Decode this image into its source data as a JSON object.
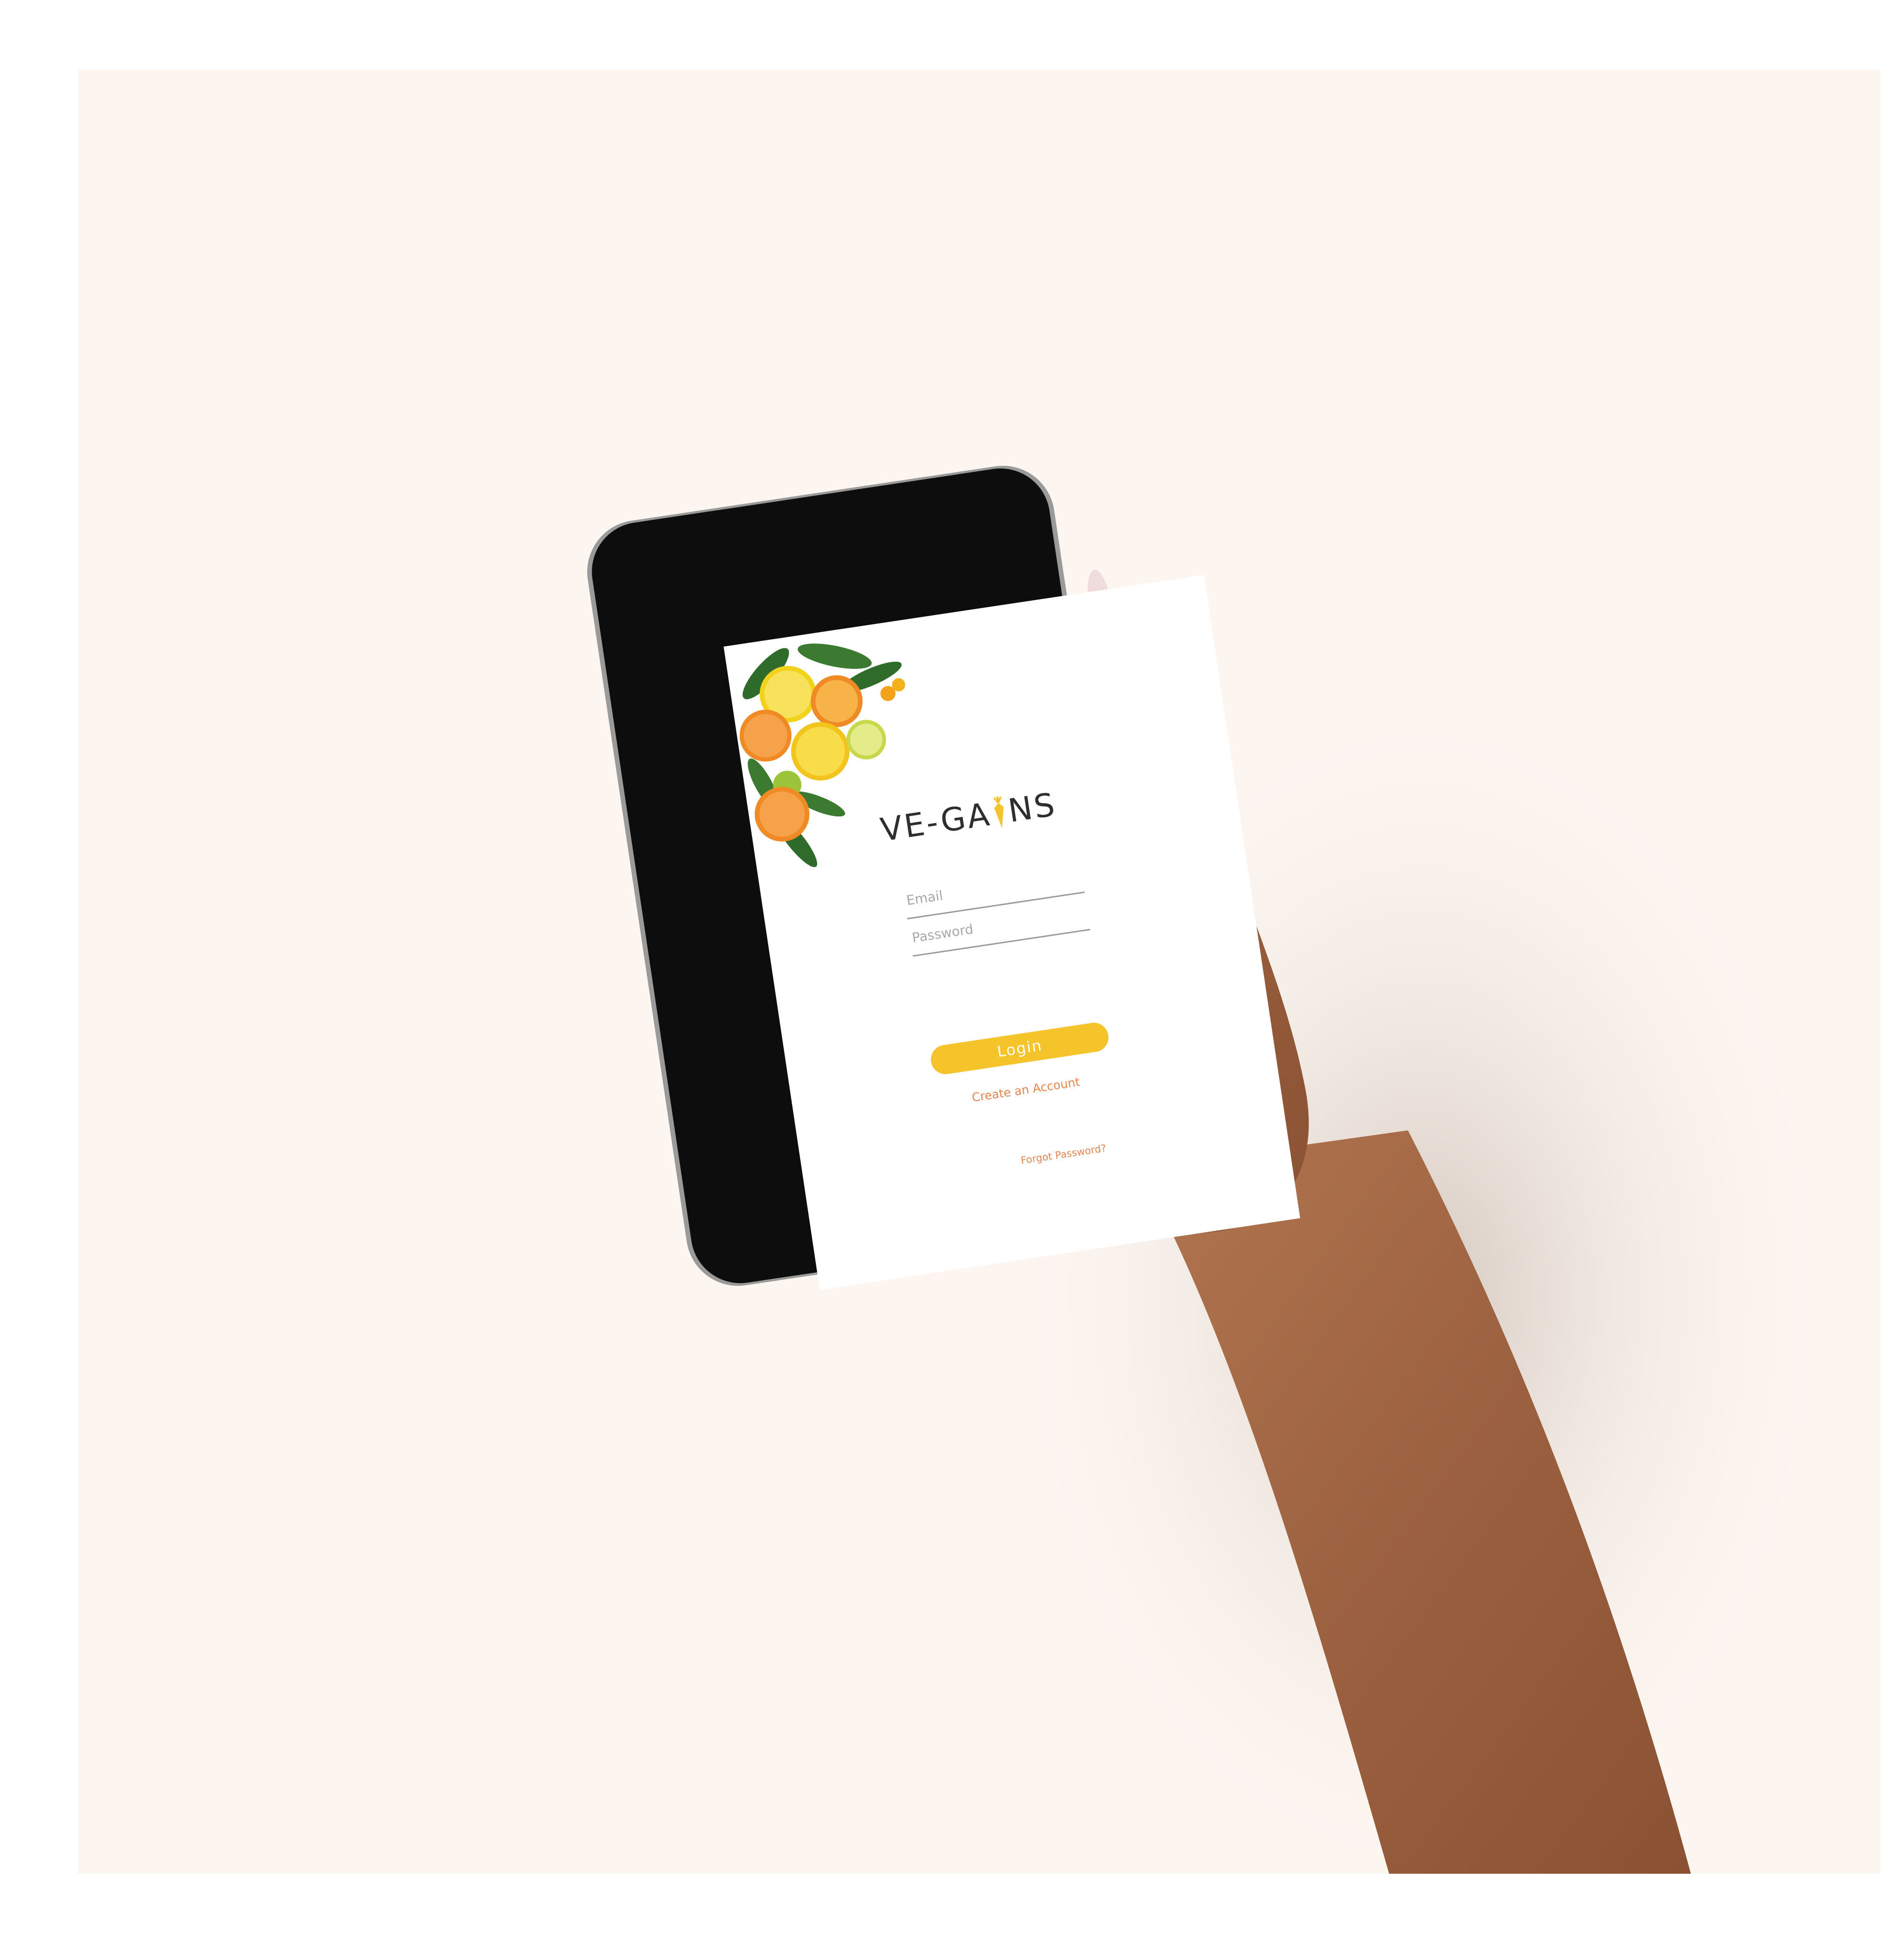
{
  "app": {
    "logo_text_left": "VE-GA",
    "logo_text_right": "NS"
  },
  "login_form": {
    "email_placeholder": "Email",
    "password_placeholder": "Password",
    "login_label": "Login",
    "create_account_label": "Create an Account",
    "forgot_password_label": "Forgot Password?"
  },
  "colors": {
    "backdrop": "#fcf5f0",
    "accent_yellow": "#f5c32a",
    "link_orange": "#e8844d",
    "logo_text": "#2e2e2e",
    "phone_body": "#0d0d0d"
  },
  "icons": {
    "logo_mark": "carrot-icon",
    "decoration": "citrus-fruit-decoration"
  }
}
